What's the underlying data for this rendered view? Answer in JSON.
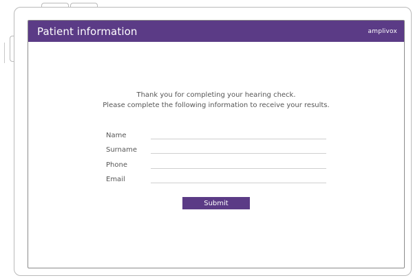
{
  "header": {
    "title": "Patient information",
    "brand": "amplivox"
  },
  "intro": {
    "line1": "Thank you for completing your hearing check.",
    "line2": "Please complete the following information to receive your results."
  },
  "form": {
    "fields": [
      {
        "label": "Name",
        "value": ""
      },
      {
        "label": "Surname",
        "value": ""
      },
      {
        "label": "Phone",
        "value": ""
      },
      {
        "label": "Email",
        "value": ""
      }
    ],
    "submit_label": "Submit"
  },
  "colors": {
    "brand_purple": "#5b3b86",
    "text_gray": "#555555"
  }
}
